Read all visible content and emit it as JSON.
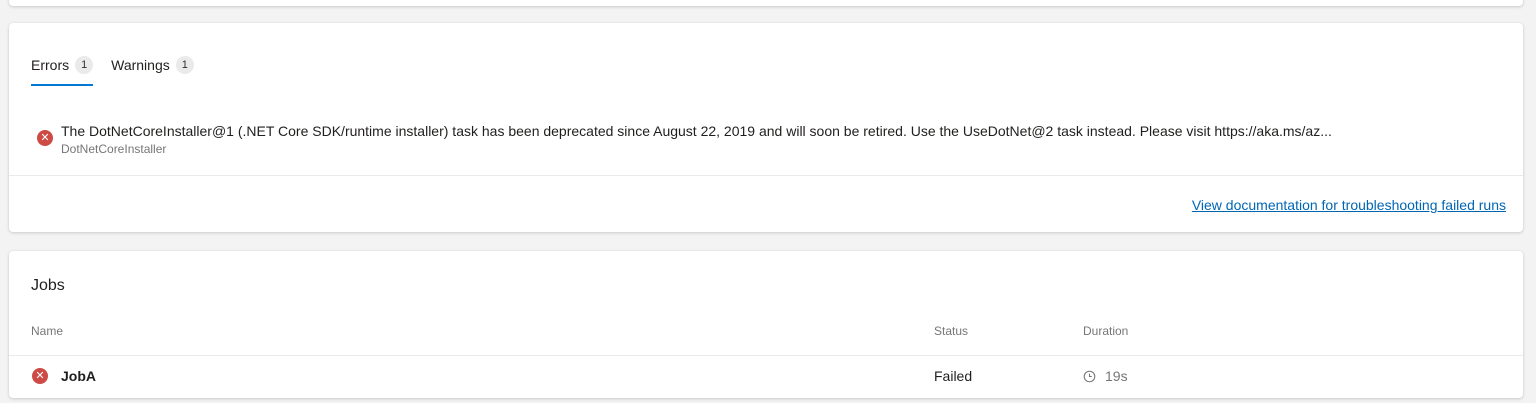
{
  "issues_panel": {
    "tabs": [
      {
        "label": "Errors",
        "count": "1",
        "selected": true
      },
      {
        "label": "Warnings",
        "count": "1",
        "selected": false
      }
    ],
    "errors": [
      {
        "icon": "error-circle-icon",
        "message": "The DotNetCoreInstaller@1 (.NET Core SDK/runtime installer) task has been deprecated since August 22, 2019 and will soon be retired. Use the UseDotNet@2 task instead. Please visit https://aka.ms/az...",
        "source": "DotNetCoreInstaller"
      }
    ],
    "doc_link": "View documentation for troubleshooting failed runs"
  },
  "jobs": {
    "title": "Jobs",
    "columns": {
      "name": "Name",
      "status": "Status",
      "duration": "Duration"
    },
    "rows": [
      {
        "status_icon": "error-circle-icon",
        "name": "JobA",
        "status": "Failed",
        "duration_icon": "clock-icon",
        "duration": "19s"
      }
    ]
  },
  "colors": {
    "accent": "#0078d4",
    "error": "#cd4a45",
    "link": "#0066b4",
    "background": "#f3f3f3"
  }
}
